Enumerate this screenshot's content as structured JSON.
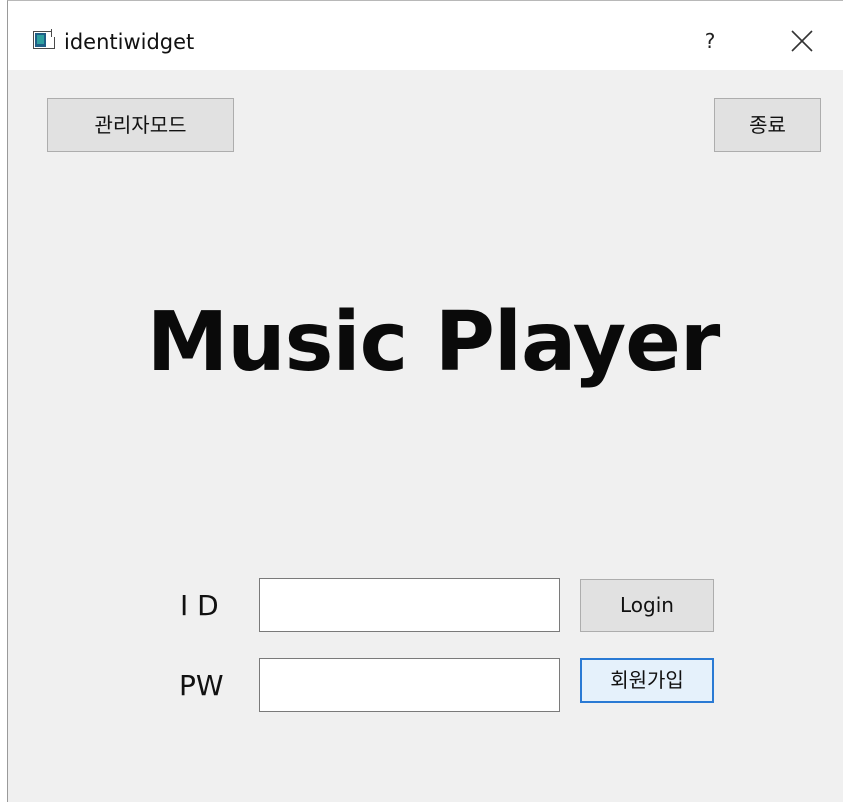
{
  "window": {
    "title": "identiwidget",
    "help_label": "?"
  },
  "toolbar": {
    "admin_mode_label": "관리자모드",
    "quit_label": "종료"
  },
  "main": {
    "headline": "Music Player"
  },
  "login_form": {
    "id_label": "I D",
    "id_value": "",
    "pw_label": "PW",
    "pw_value": "",
    "login_label": "Login",
    "signup_label": "회원가입"
  },
  "icons": {
    "app": "app-window-icon",
    "close": "close-icon"
  }
}
